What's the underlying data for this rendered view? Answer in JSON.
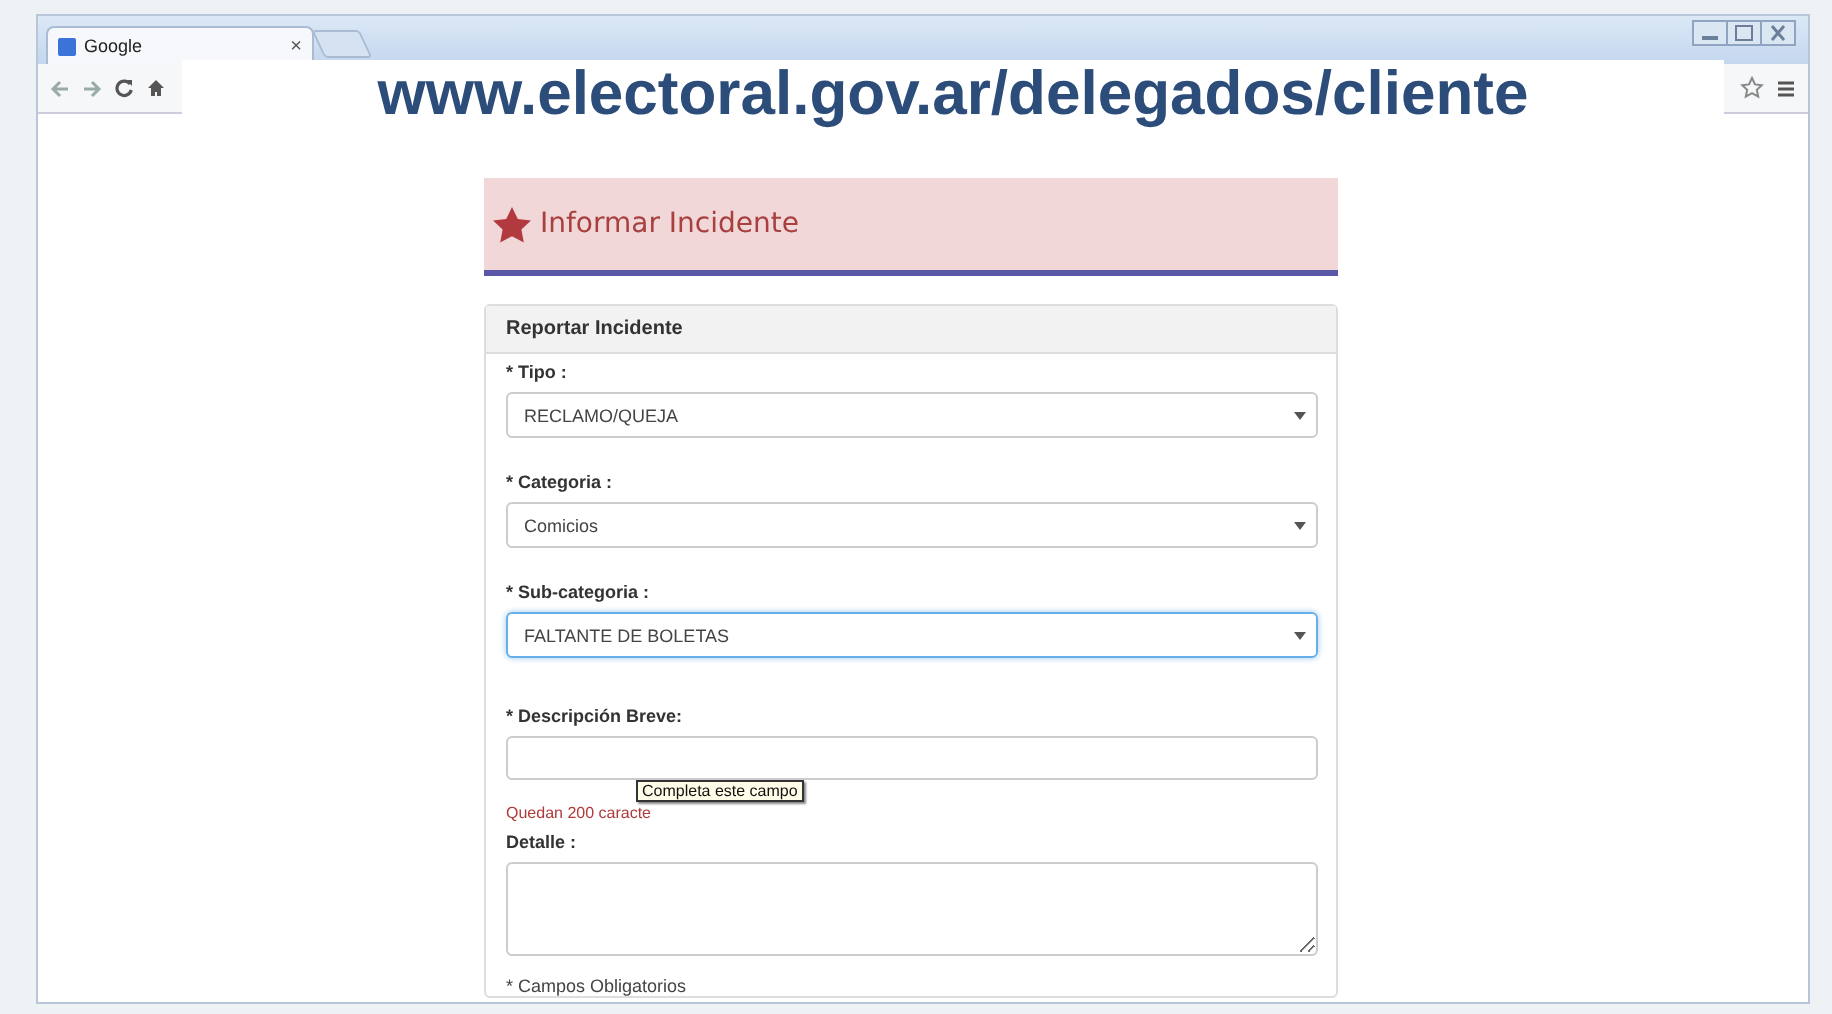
{
  "browser": {
    "tab": {
      "title": "Google",
      "close": "×"
    },
    "url": "www.electoral.gov.ar/delegados/cliente"
  },
  "page": {
    "heading": "Informar Incidente",
    "panel": {
      "title": "Reportar Incidente",
      "fields": [
        {
          "kind": "select",
          "label": "* Tipo :",
          "value": "RECLAMO/QUEJA",
          "focused": false
        },
        {
          "kind": "select",
          "label": "* Categoria :",
          "value": "Comicios",
          "focused": false
        },
        {
          "kind": "select",
          "label": "* Sub-categoria :",
          "value": "FALTANTE DE BOLETAS",
          "focused": true
        },
        {
          "kind": "text",
          "label": "* Descripción Breve:",
          "hint": "Quedan 200 caracte",
          "tooltip": "Completa este campo"
        },
        {
          "kind": "textarea",
          "label": "Detalle :"
        }
      ],
      "footnote": "* Campos Obligatorios"
    }
  }
}
